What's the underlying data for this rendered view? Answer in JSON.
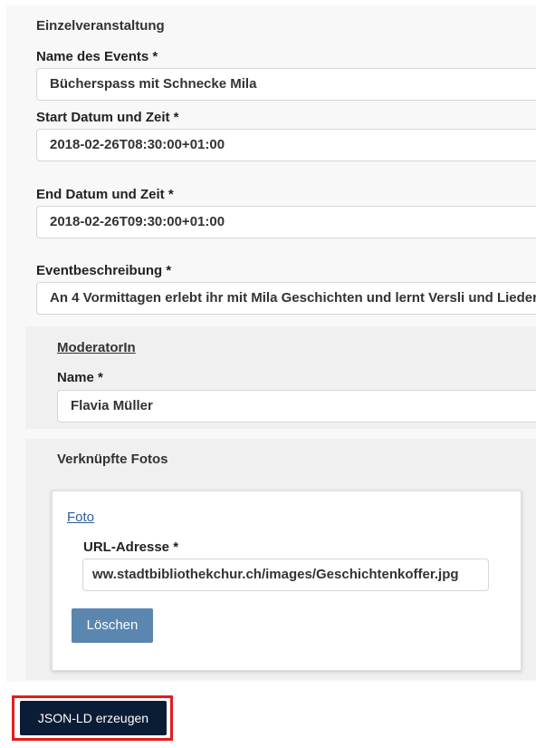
{
  "form": {
    "section_title": "Einzelveranstaltung",
    "event_name": {
      "label": "Name des Events *",
      "value": "Bücherspass mit Schnecke Mila"
    },
    "start_datetime": {
      "label": "Start Datum und Zeit *",
      "value": "2018-02-26T08:30:00+01:00"
    },
    "end_datetime": {
      "label": "End Datum und Zeit *",
      "value": "2018-02-26T09:30:00+01:00"
    },
    "description": {
      "label": "Eventbeschreibung *",
      "value": "An 4 Vormittagen erlebt ihr mit Mila Geschichten und lernt Versli und Lieder"
    }
  },
  "moderator": {
    "link_label": "ModeratorIn",
    "name": {
      "label": "Name *",
      "value": "Flavia Müller"
    }
  },
  "photos": {
    "title": "Verknüpfte Fotos",
    "card": {
      "link_label": "Foto",
      "url": {
        "label": "URL-Adresse *",
        "value": "ww.stadtbibliothekchur.ch/images/Geschichtenkoffer.jpg"
      },
      "delete_label": "Löschen"
    }
  },
  "actions": {
    "generate_label": "JSON-LD erzeugen"
  },
  "colors": {
    "link": "#2d5f99",
    "moderator_link": "#333333",
    "delete_button": "#5a86b0",
    "primary_button": "#0b1d36",
    "highlight": "#e21d1d"
  }
}
